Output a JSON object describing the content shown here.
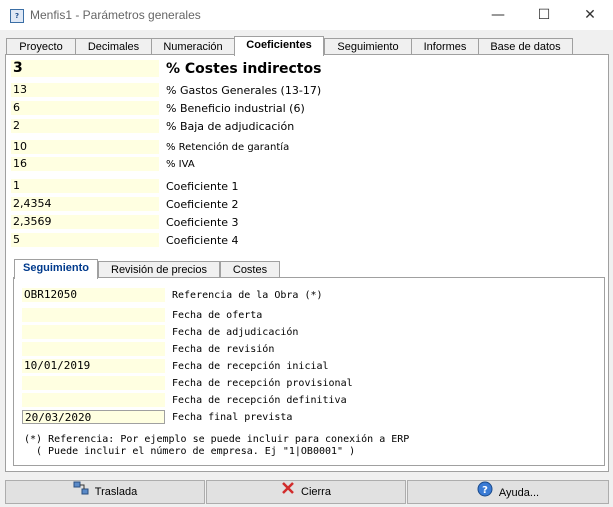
{
  "window": {
    "title": "Menfis1 - Parámetros generales",
    "minimize": "—",
    "maximize": "☐",
    "close": "✕"
  },
  "tabs": [
    "Proyecto",
    "Decimales",
    "Numeración",
    "Coeficientes",
    "Seguimiento",
    "Informes",
    "Base de datos"
  ],
  "active_tab": "Coeficientes",
  "coefficients": {
    "costes_indirectos": {
      "value": "3",
      "label": "% Costes indirectos"
    },
    "rows1": [
      {
        "value": "13",
        "label": "% Gastos Generales (13-17)"
      },
      {
        "value": "6",
        "label": "% Beneficio industrial (6)"
      },
      {
        "value": "2",
        "label": "% Baja de adjudicación"
      }
    ],
    "rows2": [
      {
        "value": "10",
        "label": "% Retención de garantía"
      },
      {
        "value": "16",
        "label": "% IVA"
      }
    ],
    "rows3": [
      {
        "value": "1",
        "label": "Coeficiente 1"
      },
      {
        "value": "2,4354",
        "label": "Coeficiente 2"
      },
      {
        "value": "2,3569",
        "label": "Coeficiente 3"
      },
      {
        "value": "5",
        "label": "Coeficiente 4"
      }
    ]
  },
  "subtabs": [
    "Seguimiento",
    "Revisión de precios",
    "Costes"
  ],
  "seguimiento": {
    "referencia": {
      "value": "OBR12050",
      "label": "Referencia de la Obra (*)"
    },
    "dates": [
      {
        "value": "",
        "label": "Fecha de oferta"
      },
      {
        "value": "",
        "label": "Fecha de adjudicación"
      },
      {
        "value": "",
        "label": "Fecha de revisión"
      },
      {
        "value": "10/01/2019",
        "label": "Fecha de recepción inicial"
      },
      {
        "value": "",
        "label": "Fecha de recepción provisional"
      },
      {
        "value": "",
        "label": "Fecha de recepción definitiva"
      },
      {
        "value": "20/03/2020",
        "label": "Fecha final prevista"
      }
    ],
    "note1": "(*) Referencia: Por ejemplo se puede incluir para conexión a ERP",
    "note2": "( Puede incluir el número de empresa. Ej \"1|OB0001\" )"
  },
  "buttons": {
    "traslada": "Traslada",
    "cierra": "Cierra",
    "ayuda": "Ayuda..."
  },
  "colors": {
    "field_bg": "#ffffe1",
    "active_subtab": "#003a8c",
    "cierra_icon": "#d12c2c"
  }
}
